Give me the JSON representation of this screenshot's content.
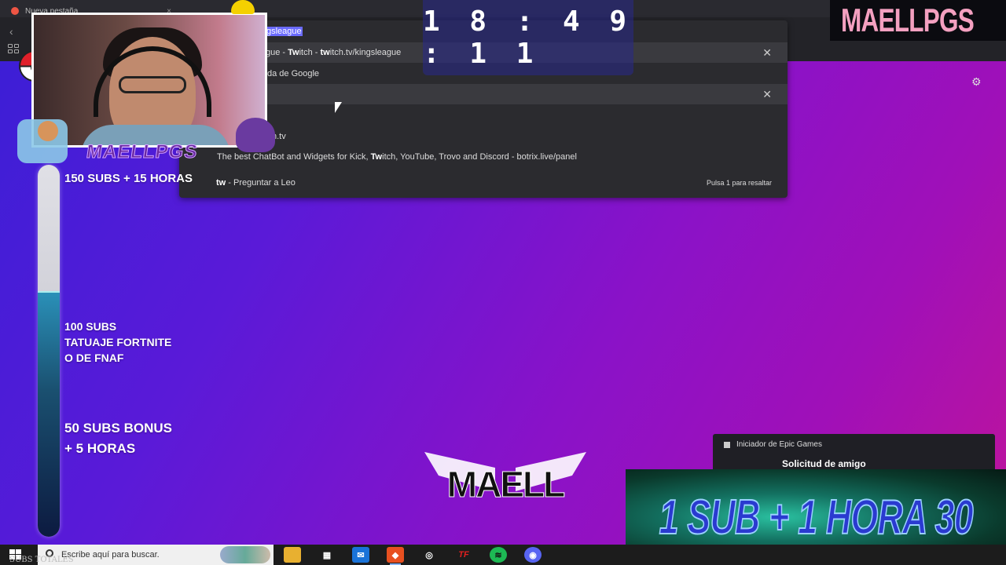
{
  "browser": {
    "tab_title": "Nueva pestaña",
    "omnibox_text": "gsleague",
    "suggestions": [
      {
        "prefix": "gue - ",
        "bold": "Tw",
        "rest": "itch - ",
        "bold2": "tw",
        "rest2": "itch.tv/kingsleague"
      },
      {
        "text": "da de Google"
      },
      {
        "text": ""
      },
      {
        "text": "h.tv"
      },
      {
        "pre": "The best ChatBot and Widgets for Kick, ",
        "bold": "Tw",
        "rest": "itch, YouTube, Trovo and Discord - botrix.live/panel"
      },
      {
        "bold": "tw",
        "rest": " - Preguntar a Leo",
        "hint": "Pulsa 1 para resaltar"
      }
    ]
  },
  "clock": "18:49:11",
  "brand": {
    "tiktok_name": "MAELLPGS"
  },
  "webcam": {
    "label": "MAELLPGS"
  },
  "goals": {
    "g1": "150 SUBS + 15 HORAS",
    "g2": [
      "100 SUBS",
      "TATUAJE FORTNITE",
      "O DE FNAF"
    ],
    "g3": [
      "50 SUBS BONUS",
      "+ 5 HORAS"
    ]
  },
  "progress": {
    "fraction": 0.66
  },
  "logo_text": "MAELL",
  "notification": {
    "app": "Iniciador de Epic Games",
    "title": "Solicitud de amigo"
  },
  "banner_text": "1 SUB + 1 HORA 30",
  "taskbar": {
    "search_placeholder": "Escribe aquí para buscar.",
    "subs_label": "SUBS TOTALES",
    "apps": [
      "file-explorer",
      "store",
      "outlook",
      "brave",
      "obs",
      "tf",
      "spotify",
      "discord"
    ]
  }
}
